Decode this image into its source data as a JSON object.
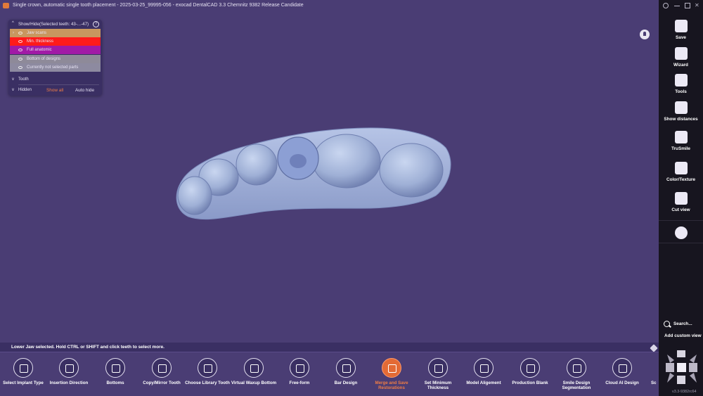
{
  "window": {
    "title": "Single crown, automatic single tooth placement - 2025-03-25_99995-056 - exocad DentalCAD 3.3 Chemnitz 9382 Release Candidate"
  },
  "layer_panel": {
    "title": "Show/Hide(Selected teeth: 43-...-47)",
    "layers": [
      {
        "label": "Jaw scans",
        "color": "#c8975f"
      },
      {
        "label": "Min. thickness",
        "color": "#ff1b1b"
      },
      {
        "label": "Full anatomic",
        "color": "#a11aa6"
      },
      {
        "label": "Bottom of designs",
        "color": "#8e8a99"
      },
      {
        "label": "Currently not selected parts",
        "color": "#8d8aa0"
      }
    ],
    "tooth_label": "Tooth",
    "hidden_label": "Hidden",
    "show_all": "Show all",
    "auto_hide": "Auto hide",
    "show_all_color": "#f07d45"
  },
  "status": {
    "message": "Lower Jaw selected. Hold CTRL or SHIFT and click teeth to select more."
  },
  "toolbar": {
    "tools": [
      {
        "label": "Select Implant Type",
        "icon": "implant-icon"
      },
      {
        "label": "Insertion Direction",
        "icon": "insertion-icon"
      },
      {
        "label": "Bottoms",
        "icon": "bottoms-icon"
      },
      {
        "label": "Copy/Mirror Tooth",
        "icon": "mirror-icon"
      },
      {
        "label": "Choose Library Tooth",
        "icon": "library-icon"
      },
      {
        "label": "Virtual Waxup Bottom",
        "icon": "waxup-icon"
      },
      {
        "label": "Free-form",
        "icon": "freeform-icon"
      },
      {
        "label": "Bar Design",
        "icon": "bar-icon"
      },
      {
        "label": "Merge and Save Restorations",
        "icon": "merge-icon",
        "active": true
      },
      {
        "label": "Set Minimum Thickness",
        "icon": "thickness-icon"
      },
      {
        "label": "Model Aligement",
        "icon": "alignment-icon"
      },
      {
        "label": "Production Blank",
        "icon": "blank-icon"
      },
      {
        "label": "Smile Design Segmentation",
        "icon": "smile-icon"
      },
      {
        "label": "Cloud AI Design",
        "icon": "cloud-ai-icon"
      }
    ],
    "partial_label": "Sc",
    "active_color": "#f07d45"
  },
  "sidebar": {
    "buttons": [
      {
        "label": "Save",
        "icon": "save-icon"
      },
      {
        "label": "Wizard",
        "icon": "wizard-icon"
      },
      {
        "label": "Tools",
        "icon": "tools-icon"
      },
      {
        "label": "Show distances",
        "icon": "distances-icon"
      },
      {
        "label": "TruSmile",
        "icon": "trusmile-icon"
      },
      {
        "label": "Color/Texture",
        "icon": "color-texture-icon"
      },
      {
        "label": "Cut view",
        "icon": "cut-view-icon"
      }
    ],
    "search_label": "Search...",
    "custom_view_label": "Add custom view",
    "version": "v3.3-9382rc64"
  }
}
